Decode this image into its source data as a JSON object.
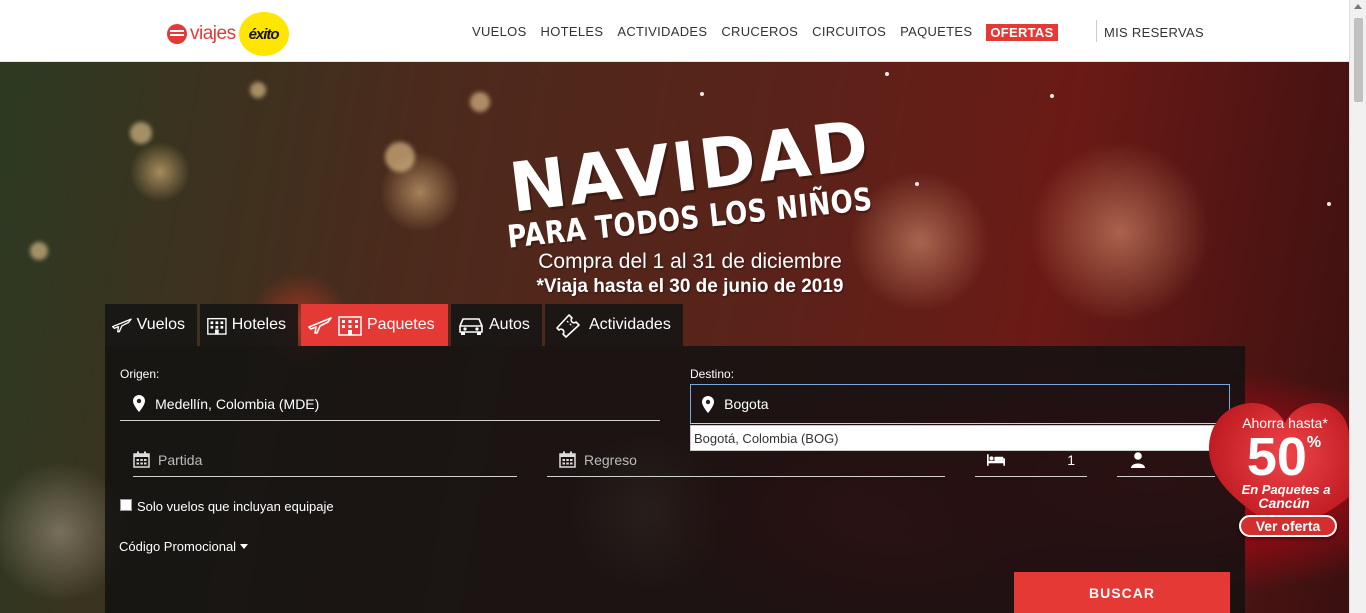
{
  "brand": {
    "name_part1": "viajes",
    "name_part2": "éxito"
  },
  "nav": {
    "items": [
      "VUELOS",
      "HOTELES",
      "ACTIVIDADES",
      "CRUCEROS",
      "CIRCUITOS",
      "PAQUETES"
    ],
    "offers": "OFERTAS",
    "reservations": "MIS RESERVAS"
  },
  "promo": {
    "title": "NAVIDAD",
    "subtitle": "PARA TODOS LOS NIÑOS",
    "dates": "Compra del 1 al 31 de diciembre",
    "travel_until": "*Viaja hasta el 30 de junio de 2019"
  },
  "tabs": [
    {
      "label": "Vuelos",
      "icon": "plane-icon",
      "active": false
    },
    {
      "label": "Hoteles",
      "icon": "building-icon",
      "active": false
    },
    {
      "label": "Paquetes",
      "icon": "plane-building-icon",
      "active": true
    },
    {
      "label": "Autos",
      "icon": "car-icon",
      "active": false
    },
    {
      "label": "Actividades",
      "icon": "ticket-icon",
      "active": false
    }
  ],
  "search": {
    "origin_label": "Origen:",
    "origin_value": "Medellín, Colombia (MDE)",
    "destination_label": "Destino:",
    "destination_value": "Bogota",
    "suggestion": "Bogotá, Colombia (BOG)",
    "departure_placeholder": "Partida",
    "return_placeholder": "Regreso",
    "rooms_value": "1",
    "luggage_checkbox": "Solo vuelos que incluyan equipaje",
    "promo_code": "Código Promocional",
    "submit": "BUSCAR"
  },
  "offer_badge": {
    "line1": "Ahorra hasta*",
    "percent": "50",
    "percent_sign": "%",
    "line2": "En Paquetes a",
    "line3": "Cancún",
    "cta": "Ver oferta"
  },
  "colors": {
    "accent": "#e53935",
    "badge_yellow": "#ffe600",
    "panel": "#121212"
  }
}
